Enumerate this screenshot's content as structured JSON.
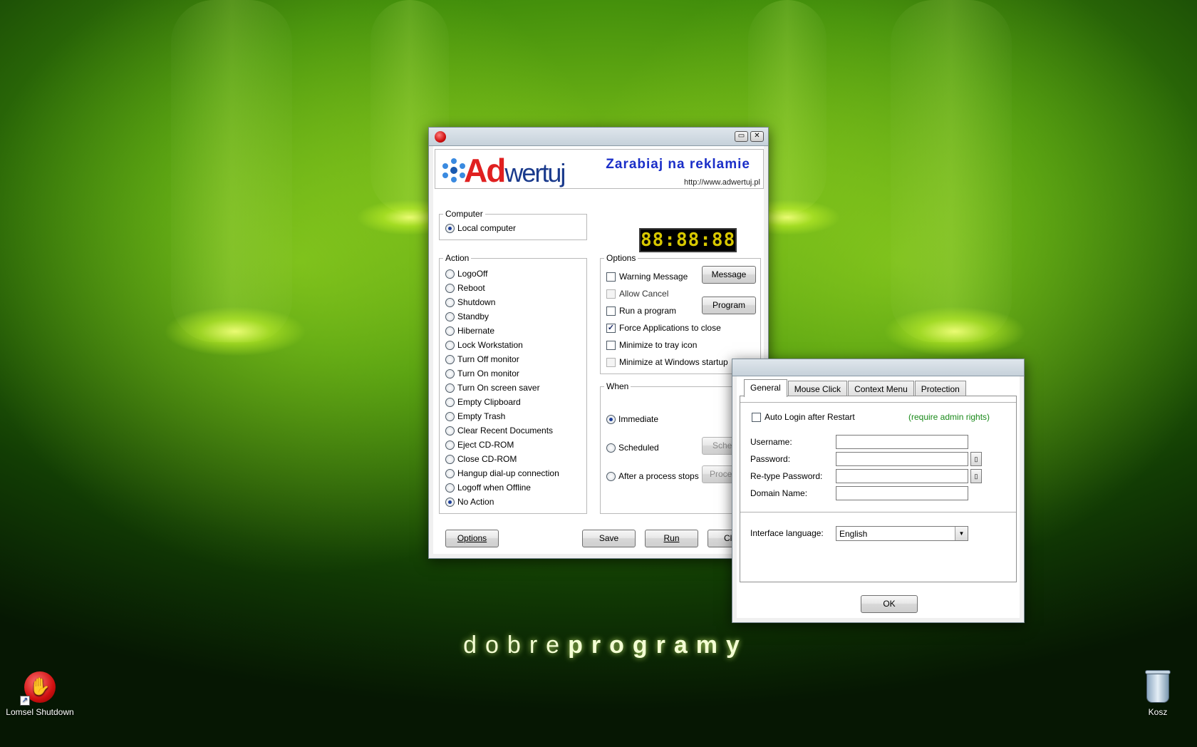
{
  "desktop": {
    "brand_light": "dobre",
    "brand_bold": "programy",
    "icons": [
      {
        "label": "Lomsel Shutdown"
      },
      {
        "label": "Kosz"
      }
    ]
  },
  "main_window": {
    "banner": {
      "logo_red": "Ad",
      "logo_blue": "wertuj",
      "slogan": "Zarabiaj na reklamie",
      "url": "http://www.adwertuj.pl"
    },
    "clock": "88:88:88",
    "computer": {
      "legend": "Computer",
      "option": "Local computer"
    },
    "action": {
      "legend": "Action",
      "items": [
        "LogoOff",
        "Reboot",
        "Shutdown",
        "Standby",
        "Hibernate",
        "Lock Workstation",
        "Turn Off monitor",
        "Turn On monitor",
        "Turn On screen saver",
        "Empty Clipboard",
        "Empty Trash",
        "Clear Recent Documents",
        "Eject CD-ROM",
        "Close CD-ROM",
        "Hangup dial-up connection",
        "Logoff when Offline",
        "No Action"
      ],
      "selected": "No Action"
    },
    "options": {
      "legend": "Options",
      "warning_message": "Warning Message",
      "message_button": "Message",
      "allow_cancel": "Allow Cancel",
      "run_program": "Run a program",
      "program_button": "Program",
      "force_close": "Force Applications to close",
      "minimize_tray": "Minimize to tray icon",
      "minimize_startup": "Minimize at Windows startup"
    },
    "when": {
      "legend": "When",
      "immediate": "Immediate",
      "scheduled": "Scheduled",
      "schedule_button": "Sche",
      "after_process": "After a process stops",
      "process_button": "Proce"
    },
    "buttons": {
      "options": "Options",
      "save": "Save",
      "run": "Run",
      "close": "Cl"
    }
  },
  "options_dialog": {
    "tabs": [
      "General",
      "Mouse Click",
      "Context Menu",
      "Protection"
    ],
    "auto_login": "Auto Login after Restart",
    "admin_note": "(require admin rights)",
    "username_label": "Username:",
    "password_label": "Password:",
    "retype_label": "Re-type Password:",
    "domain_label": "Domain Name:",
    "language_label": "Interface language:",
    "language_value": "English",
    "ok_button": "OK"
  },
  "colors": {
    "admin_note": "#1a8a1a",
    "slogan": "#1a2ec8",
    "clock_digits": "#d8c800"
  }
}
